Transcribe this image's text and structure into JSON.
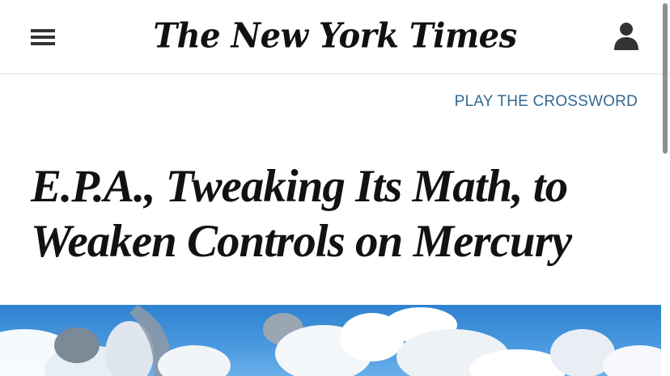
{
  "header": {
    "logo_text": "The New York Times",
    "menu_icon": "hamburger-menu-icon",
    "account_icon": "user-account-icon"
  },
  "promo": {
    "crossword_link": "PLAY THE CROSSWORD",
    "link_color": "#326891"
  },
  "article": {
    "headline": "E.P.A., Tweaking Its Math, to Weaken Controls on Mercury"
  },
  "colors": {
    "sky": "#3a8ad6",
    "text": "#121212"
  }
}
